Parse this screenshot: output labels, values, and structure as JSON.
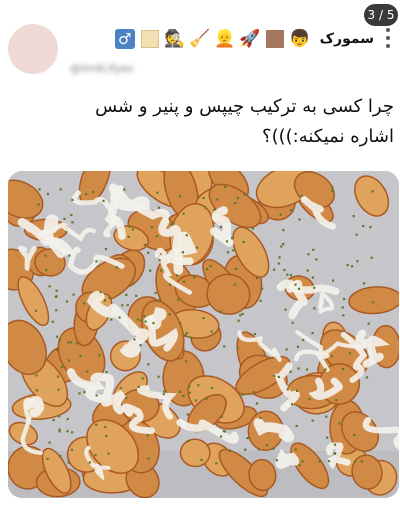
{
  "pager": {
    "counter": "3 / 5"
  },
  "author": {
    "display_name": "سمورک",
    "emojis": [
      {
        "name": "boy-face-icon",
        "glyph": "👦"
      },
      {
        "name": "brown-square-icon",
        "glyph": ""
      },
      {
        "name": "rocket-icon",
        "glyph": "🚀"
      },
      {
        "name": "blonde-person-icon",
        "glyph": "👱"
      },
      {
        "name": "vacuum-icon",
        "glyph": "🧹"
      },
      {
        "name": "detective-icon",
        "glyph": "🕵"
      },
      {
        "name": "beige-square-icon",
        "glyph": ""
      },
      {
        "name": "male-sign-icon",
        "glyph": "♂"
      }
    ],
    "handle": "@im4Lifyes"
  },
  "tweet": {
    "line1": "چرا کسی به ترکیب چیپس و پنیر و شس",
    "line2": "اشاره نمیکنه:)))؟"
  },
  "media": {
    "alt": ""
  },
  "colors": {
    "chip": "#d08a45",
    "chip_dark": "#a85a24",
    "sauce": "#f3f1ea",
    "herb": "#5a7a2c",
    "plate": "#c7c7cb"
  }
}
